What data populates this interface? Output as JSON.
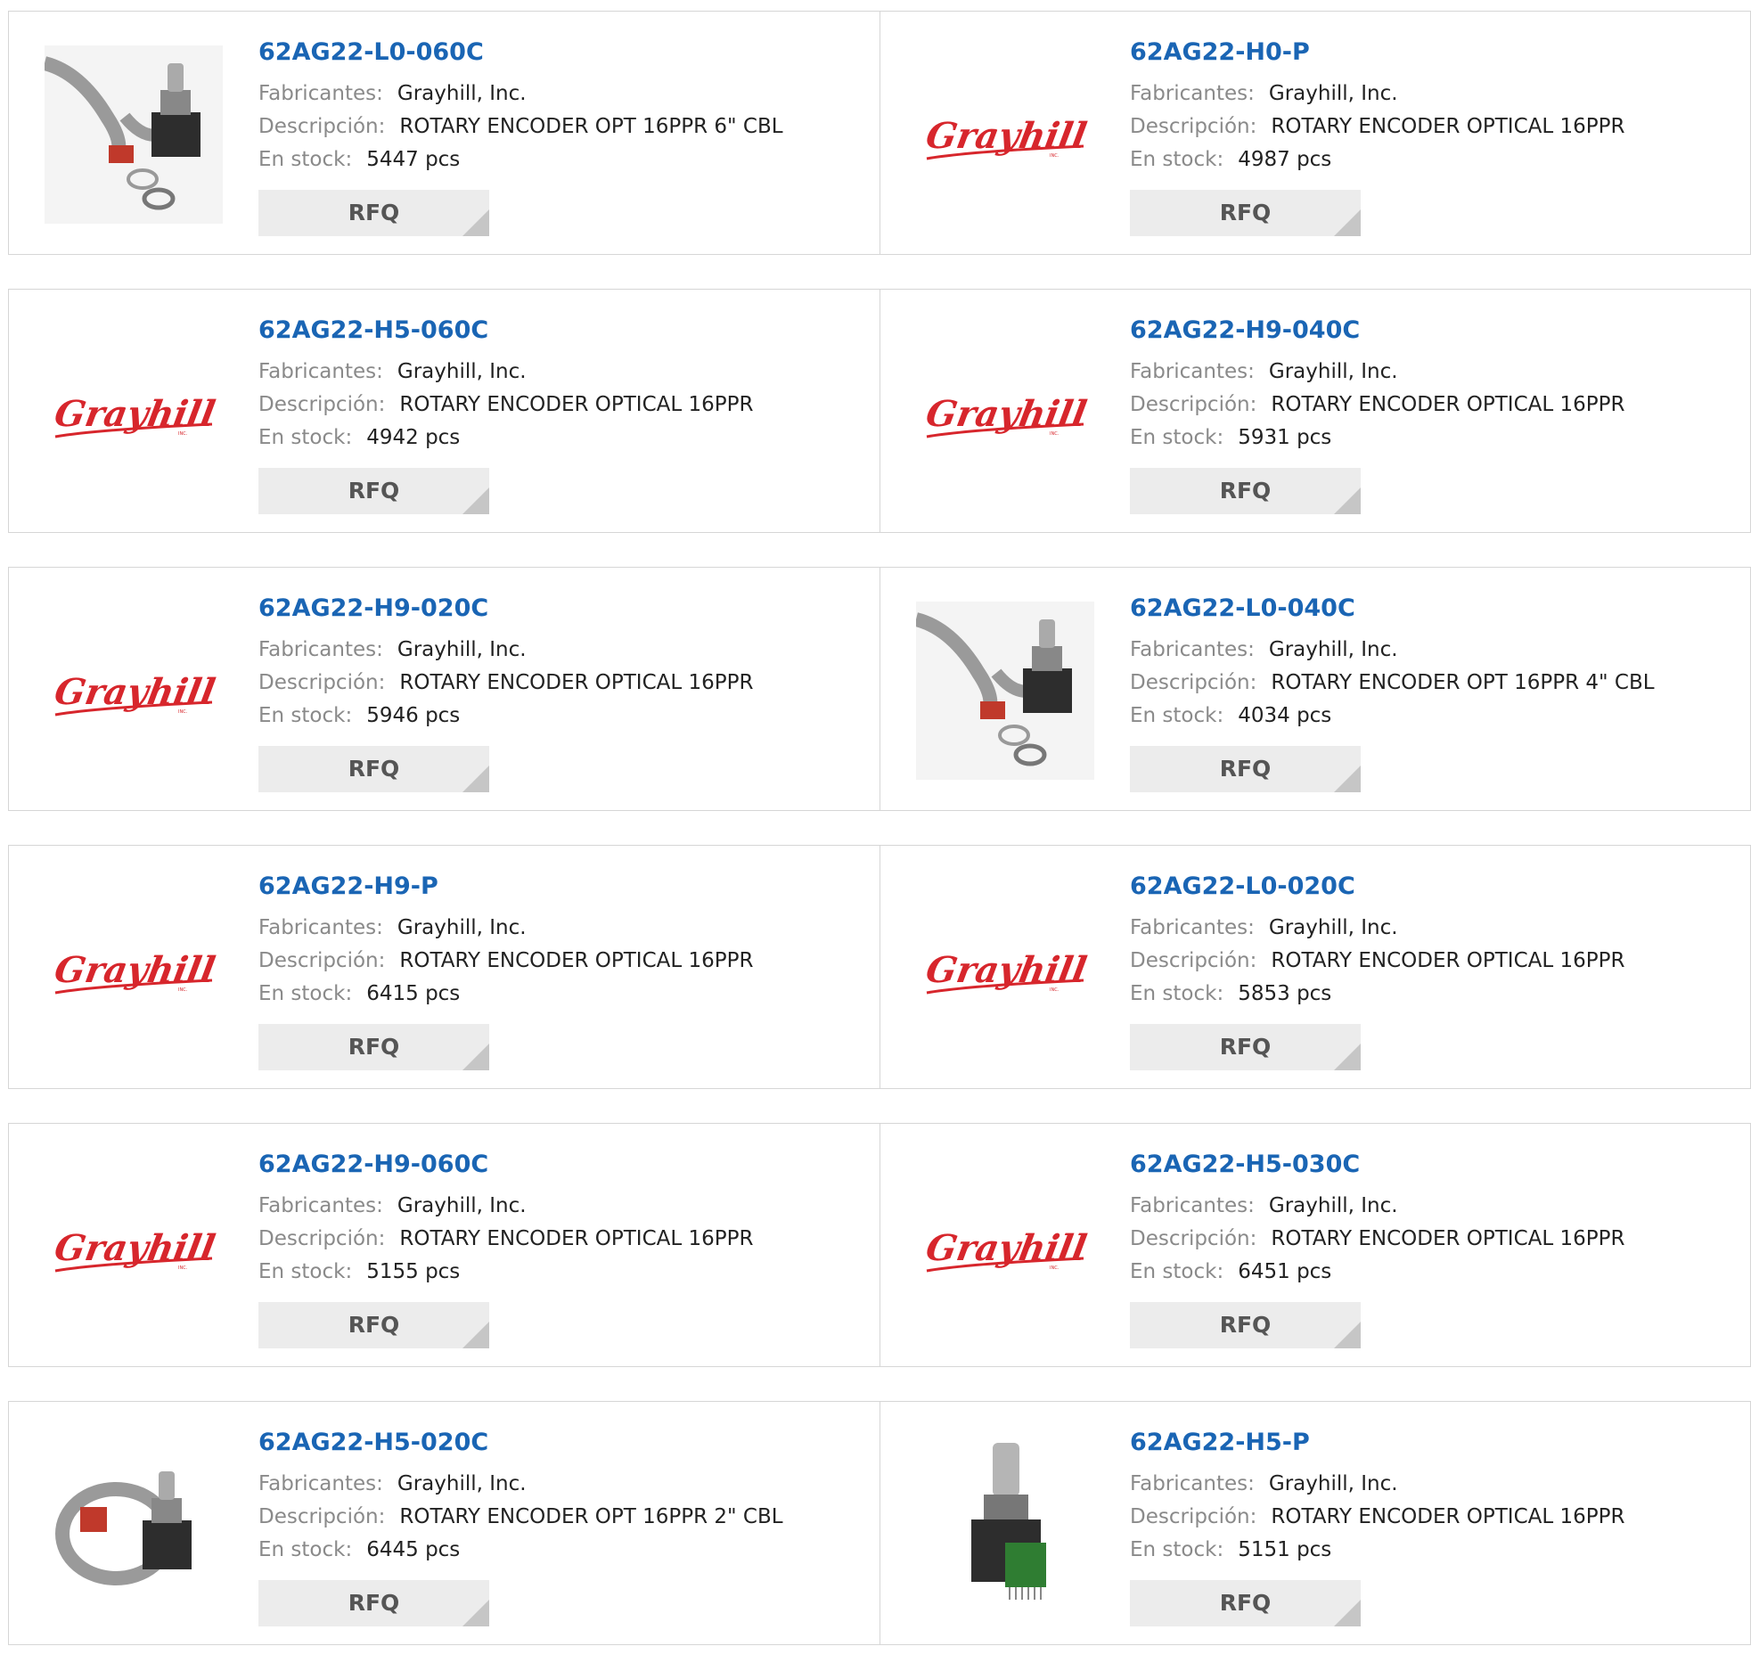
{
  "labels": {
    "manufacturer": "Fabricantes:",
    "description": "Descripción:",
    "stock": "En stock:",
    "rfq": "RFQ",
    "logo_text": "Grayhill",
    "logo_sub": "INC."
  },
  "colors": {
    "link": "#1a65b4",
    "logo": "#d7262c",
    "button_bg": "#ececec"
  },
  "products": [
    {
      "part": "62AG22-L0-060C",
      "manufacturer": "Grayhill, Inc.",
      "description": "ROTARY ENCODER OPT 16PPR 6\" CBL",
      "stock": "5447 pcs",
      "image": "encoder-with-flat-cable-photo"
    },
    {
      "part": "62AG22-H0-P",
      "manufacturer": "Grayhill, Inc.",
      "description": "ROTARY ENCODER OPTICAL 16PPR",
      "stock": "4987 pcs",
      "image": "grayhill-logo"
    },
    {
      "part": "62AG22-H5-060C",
      "manufacturer": "Grayhill, Inc.",
      "description": "ROTARY ENCODER OPTICAL 16PPR",
      "stock": "4942 pcs",
      "image": "grayhill-logo"
    },
    {
      "part": "62AG22-H9-040C",
      "manufacturer": "Grayhill, Inc.",
      "description": "ROTARY ENCODER OPTICAL 16PPR",
      "stock": "5931 pcs",
      "image": "grayhill-logo"
    },
    {
      "part": "62AG22-H9-020C",
      "manufacturer": "Grayhill, Inc.",
      "description": "ROTARY ENCODER OPTICAL 16PPR",
      "stock": "5946 pcs",
      "image": "grayhill-logo"
    },
    {
      "part": "62AG22-L0-040C",
      "manufacturer": "Grayhill, Inc.",
      "description": "ROTARY ENCODER OPT 16PPR 4\" CBL",
      "stock": "4034 pcs",
      "image": "encoder-with-flat-cable-photo"
    },
    {
      "part": "62AG22-H9-P",
      "manufacturer": "Grayhill, Inc.",
      "description": "ROTARY ENCODER OPTICAL 16PPR",
      "stock": "6415 pcs",
      "image": "grayhill-logo"
    },
    {
      "part": "62AG22-L0-020C",
      "manufacturer": "Grayhill, Inc.",
      "description": "ROTARY ENCODER OPTICAL 16PPR",
      "stock": "5853 pcs",
      "image": "grayhill-logo"
    },
    {
      "part": "62AG22-H9-060C",
      "manufacturer": "Grayhill, Inc.",
      "description": "ROTARY ENCODER OPTICAL 16PPR",
      "stock": "5155 pcs",
      "image": "grayhill-logo"
    },
    {
      "part": "62AG22-H5-030C",
      "manufacturer": "Grayhill, Inc.",
      "description": "ROTARY ENCODER OPTICAL 16PPR",
      "stock": "6451 pcs",
      "image": "grayhill-logo"
    },
    {
      "part": "62AG22-H5-020C",
      "manufacturer": "Grayhill, Inc.",
      "description": "ROTARY ENCODER OPT 16PPR 2\" CBL",
      "stock": "6445 pcs",
      "image": "encoder-with-coiled-cable-photo"
    },
    {
      "part": "62AG22-H5-P",
      "manufacturer": "Grayhill, Inc.",
      "description": "ROTARY ENCODER OPTICAL 16PPR",
      "stock": "5151 pcs",
      "image": "encoder-with-pins-photo"
    }
  ]
}
